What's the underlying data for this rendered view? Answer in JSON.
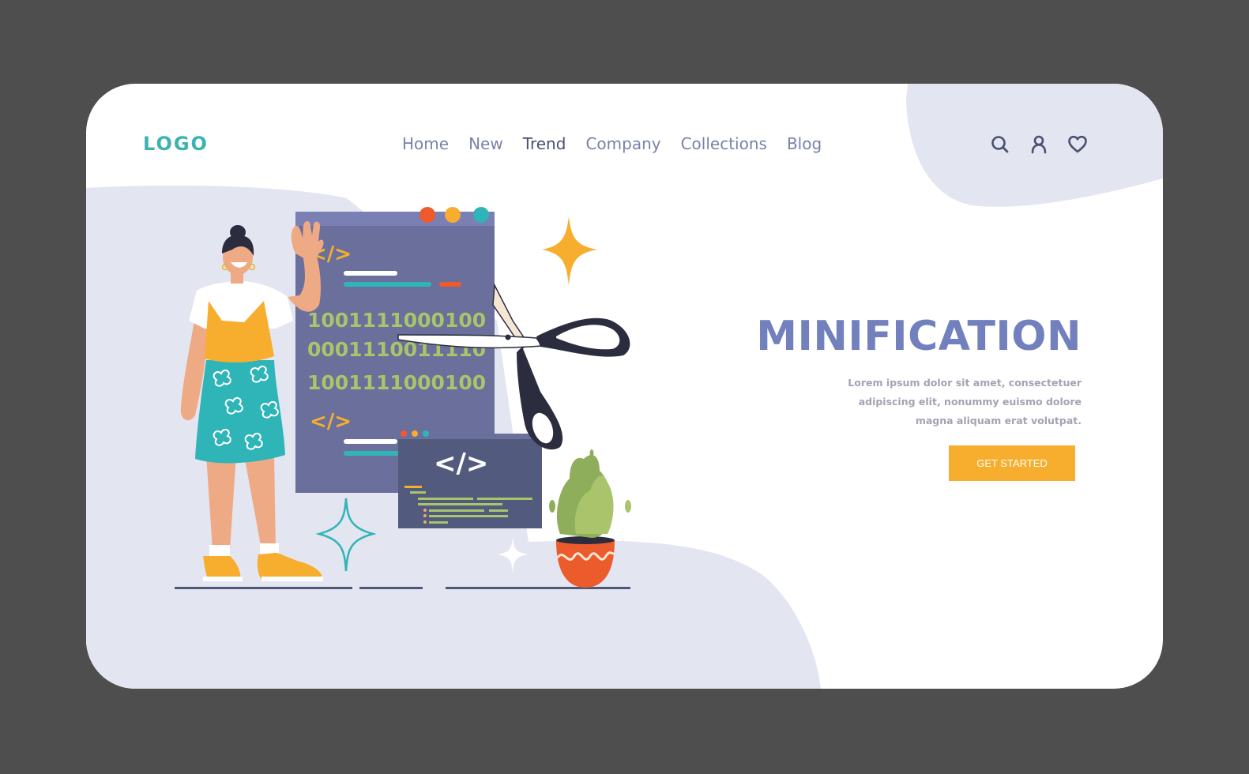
{
  "header": {
    "logo": "LOGO",
    "nav": [
      {
        "label": "Home",
        "active": false
      },
      {
        "label": "New",
        "active": false
      },
      {
        "label": "Trend",
        "active": true
      },
      {
        "label": "Company",
        "active": false
      },
      {
        "label": "Collections",
        "active": false
      },
      {
        "label": "Blog",
        "active": false
      }
    ],
    "icons": [
      "search-icon",
      "user-icon",
      "heart-icon"
    ]
  },
  "hero": {
    "title": "MINIFICATION",
    "description_lines": [
      "Lorem ipsum dolor sit amet, consectetuer",
      "adipiscing elit, nonummy euismo dolore",
      "magna aliquam erat volutpat."
    ],
    "cta_label": "GET STARTED"
  },
  "illustration": {
    "code_tag": "</>",
    "binary_lines": [
      "1001111000100",
      "0001110011110",
      "1001111000100"
    ],
    "small_window_tag": "</>"
  },
  "colors": {
    "frame": "#4e4e4e",
    "accent_teal": "#3bb3b0",
    "title_blue": "#7280bd",
    "cta_orange": "#f7ae2e",
    "blob": "#e3e5f0",
    "window": "#6a6f9c"
  }
}
